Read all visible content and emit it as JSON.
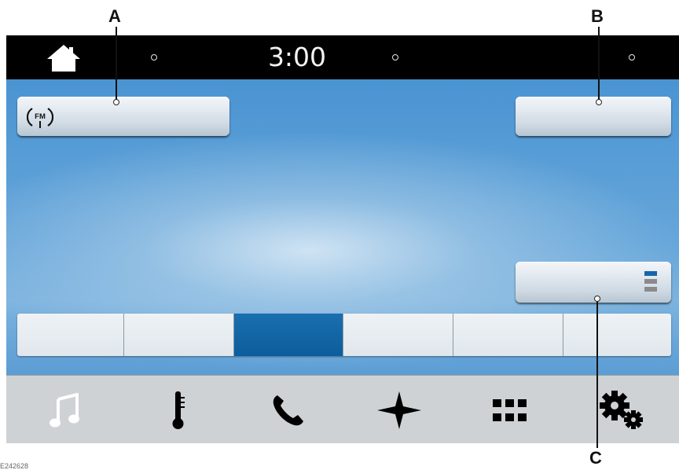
{
  "callouts": {
    "a": "A",
    "b": "B",
    "c": "C"
  },
  "status_bar": {
    "time": "3:00",
    "home_icon": "home-icon"
  },
  "source_button": {
    "icon": "fm-radio-icon",
    "label": ""
  },
  "top_right_button": {
    "label": ""
  },
  "presets_button": {
    "icon": "presets-list-icon"
  },
  "presets": [
    {
      "label": "",
      "active": false
    },
    {
      "label": "",
      "active": false
    },
    {
      "label": "",
      "active": true
    },
    {
      "label": "",
      "active": false
    },
    {
      "label": "",
      "active": false
    },
    {
      "label": "",
      "active": false
    }
  ],
  "nav": [
    {
      "name": "audio",
      "icon": "music-note-icon",
      "active": true
    },
    {
      "name": "climate",
      "icon": "thermometer-icon",
      "active": false
    },
    {
      "name": "phone",
      "icon": "phone-icon",
      "active": false
    },
    {
      "name": "navigation",
      "icon": "navigation-star-icon",
      "active": false
    },
    {
      "name": "apps",
      "icon": "apps-grid-icon",
      "active": false
    },
    {
      "name": "settings",
      "icon": "settings-gears-icon",
      "active": false
    }
  ],
  "colors": {
    "accent": "#0f64a6",
    "status_bar": "#000000",
    "background": "#4a94d2"
  },
  "figure_id": "E242628"
}
